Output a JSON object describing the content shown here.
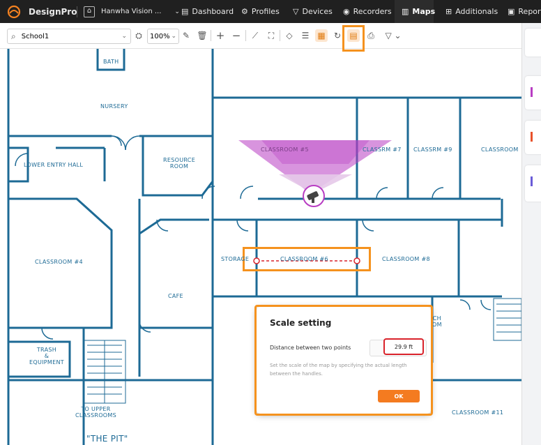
{
  "topnav": {
    "brand": "DesignPro",
    "project": "Hanwha Vision ...",
    "tabs": [
      "Dashboard",
      "Profiles",
      "Devices",
      "Recorders",
      "Maps",
      "Additionals",
      "Report"
    ],
    "active_tab": "Maps"
  },
  "toolbar": {
    "map_select": "School1",
    "zoom": "100%"
  },
  "map": {
    "rooms": {
      "bath": "BATH",
      "nursery": "NURSERY",
      "lower_entry_hall": "LOWER ENTRY HALL",
      "resource_room": "RESOURCE\nROOM",
      "classroom_5": "CLASSROOM #5",
      "classrm_7": "CLASSRM #7",
      "classrm_9": "CLASSRM #9",
      "classroom_right": "CLASSROOM",
      "classroom_4": "CLASSROOM #4",
      "storage": "STORAGE",
      "classroom_6": "CLASSROOM #6",
      "classroom_8": "CLASSROOM #8",
      "cafe": "CAFE",
      "trash_equipment": "TRASH\n&\nEQUIPMENT",
      "to_upper_classrooms": "TO UPPER\nCLASSROOMS",
      "the_pit": "\"THE PIT\"",
      "classroom_11": "CLASSROOM #11",
      "partial_ch_om": "CH\nOM"
    }
  },
  "dialog": {
    "title": "Scale setting",
    "distance_label": "Distance between two points",
    "distance_value": "29.9 ft",
    "help_text": "Set the scale of the map by specifying the actual length between the handles.",
    "ok_label": "OK"
  },
  "colors": {
    "accent": "#f5921e",
    "ok_button": "#f47b20",
    "wall": "#1d6a95",
    "camera_fov": "#b83dc3",
    "scale_line": "#d9222a",
    "nav_bg": "#202020"
  }
}
